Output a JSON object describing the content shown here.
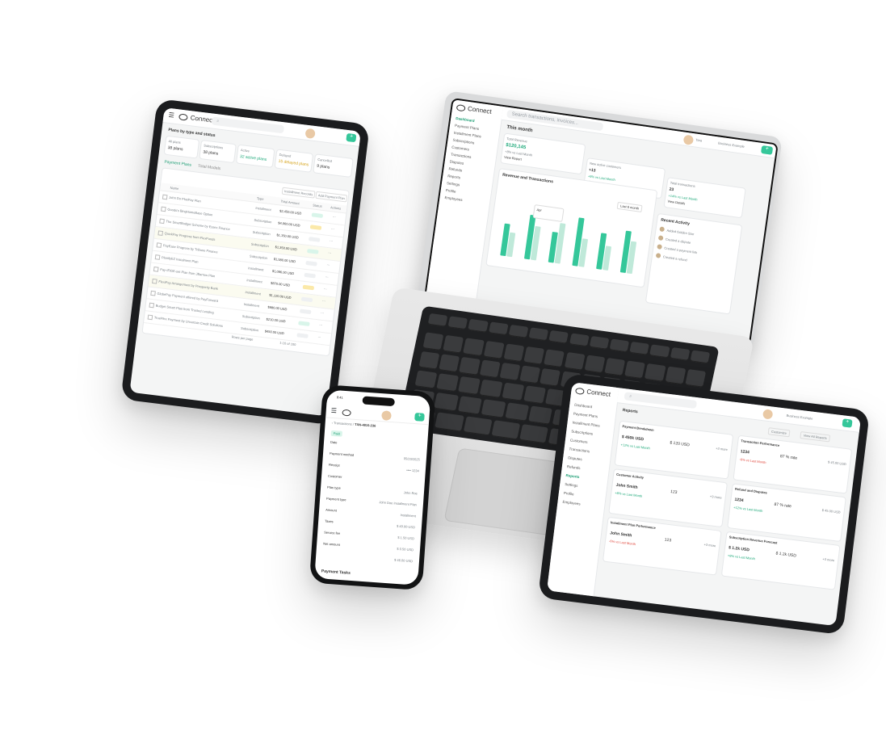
{
  "laptop": {
    "app_name": "Connect",
    "search_placeholder": "Search transactions, invoices...",
    "nav": [
      "Dashboard",
      "Payment Plans",
      "Installment Plans",
      "Subscriptions",
      "Customers",
      "Transactions",
      "Disputes",
      "Refunds",
      "Reports",
      "Settings",
      "Profile",
      "Employees"
    ],
    "section_title": "This month",
    "total_revenue_label": "Total Revenue",
    "total_revenue_value": "$120,145",
    "total_revenue_change": "+8% vs Last Month",
    "view_report": "View Report",
    "new_active_label": "New active customers",
    "new_active_value": "+13",
    "new_active_change": "+6% vs Last Month",
    "view_details": "View Details",
    "total_transactions_label": "Total transactions",
    "total_transactions_value": "23",
    "total_transactions_change": "+14% vs Last Month",
    "chart_title": "Revenue and Transactions",
    "chart_period": "Last 6 month",
    "chart_tooltip": "Apr",
    "recent_activity_title": "Recent Activity",
    "activity": [
      "Added Golden Star",
      "Created a dispute",
      "Created a payment link",
      "Created a refund"
    ],
    "user_name": "Tara",
    "business_name": "Business Example"
  },
  "tablet_left": {
    "app_name": "Connect",
    "title": "Plans by type and status",
    "stats": [
      "All plans",
      "Subscriptions",
      "Active",
      "Delayed",
      "Cancelled"
    ],
    "stat_values": [
      "38 plans",
      "38 plans",
      "32 active plans",
      "15 delayed plans",
      "9 plans"
    ],
    "tabs": [
      "Payment Plans",
      "Total Models"
    ],
    "buttons": [
      "Installment Records",
      "Add Payment Plan"
    ],
    "columns": [
      "Name",
      "Type",
      "Total Amount",
      "Status",
      "Actions"
    ],
    "rows": [
      [
        "John Do PlusPay Plan",
        "Installment",
        "$2,450.00 USD"
      ],
      [
        "Goods's BingHomeBase Option",
        "Subscription",
        "$4,060.00 USD"
      ],
      [
        "The SmartBudget Scheme by Essex Finance",
        "Subscription",
        "$1,150.00 USD"
      ],
      [
        "QuickPay Progress from FlexFunds",
        "Subscription",
        "$1,350.00 USD"
      ],
      [
        "PayEase Progress by Tribune Finance",
        "Subscription",
        "$1,580.00 USD"
      ],
      [
        "PlanifyEZ Instalment Plan",
        "Installment",
        "$1,096.00 USD"
      ],
      [
        "Pay-IFIGE-set Plan from JBarrow Plan",
        "Installment",
        "$870.00 USD"
      ],
      [
        "FlexiPay Arrangement by Prosperity Bank",
        "Installment",
        "$1,120.00 USD"
      ],
      [
        "GlobePay Payment offered by PayForward",
        "Installment",
        "$980.00 USD"
      ],
      [
        "Budget Smart Plan from Trusted Lending",
        "Subscription",
        "$210.00 USD"
      ],
      [
        "TruePlex Payment by Uncertain Credit Solutions",
        "Subscription",
        "$450.00 USD"
      ]
    ],
    "pagination": "1-10 of 100",
    "rows_per_page": "Rows per page"
  },
  "phone": {
    "breadcrumb": "Transactions",
    "txn_id": "TXN-4810-236",
    "status": "Paid",
    "fields": [
      [
        "Date",
        ""
      ],
      [
        "Payment method",
        "05/23/2025"
      ],
      [
        "Receipt",
        "•••• 1234"
      ],
      [
        "Customer",
        ""
      ],
      [
        "Plan type",
        "John Roe"
      ],
      [
        "Payment type",
        "John Doe Installment Plan"
      ],
      [
        "Amount",
        "Installment"
      ],
      [
        "Taxes",
        "$ 49.00 USD"
      ],
      [
        "Service fee",
        "$ 1.50 USD"
      ],
      [
        "Net amount",
        "$ 0.50 USD"
      ],
      [
        "",
        "$ 46.00 USD"
      ]
    ],
    "section": "Payment Tasks",
    "time": "9:41"
  },
  "tablet_right": {
    "app_name": "Connect",
    "page_title": "Reports",
    "nav": [
      "Dashboard",
      "Payment Plans",
      "Installment Plans",
      "Subscriptions",
      "Customers",
      "Transactions",
      "Disputes",
      "Refunds",
      "Reports",
      "Settings",
      "Profile",
      "Employees"
    ],
    "customize": "Customize",
    "view_all": "View All Reports",
    "sections": [
      "Payment Breakdown",
      "Transaction Performance",
      "Customer Activity",
      "Refund and Disputes",
      "Installment Plan Performance",
      "Subscription Revenue Forecast"
    ],
    "values": [
      "$ 450k USD",
      "$ 120 USD",
      "+3 more",
      "1234",
      "87 % rate",
      "$ 45.00 USD",
      "John Smith",
      "123",
      "+3 more",
      "1234",
      "87 % rate",
      "$ 45.00 USD",
      "John Smith",
      "123",
      "+3 more",
      "$ 1.2k USD",
      "$ 1.2k USD",
      "+3 more"
    ],
    "changes": [
      "+12% vs Last Month",
      "-6% vs Last Month",
      "+8% vs Last Month"
    ],
    "business_name": "Business Example"
  }
}
